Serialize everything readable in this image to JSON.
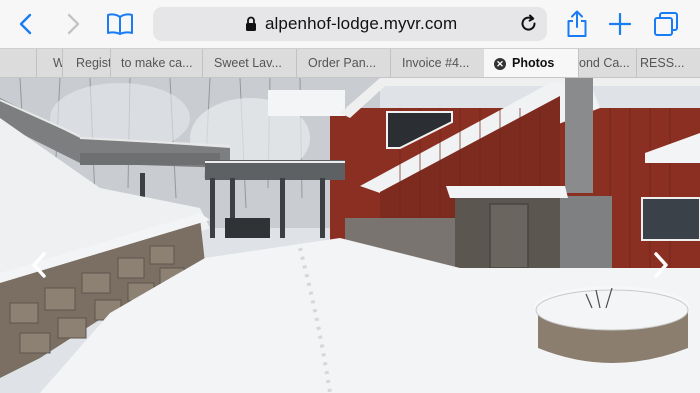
{
  "browser": {
    "url": "alpenhof-lodge.myvr.com",
    "tabs": [
      {
        "label": "W"
      },
      {
        "label": "Regist"
      },
      {
        "label": "to make ca..."
      },
      {
        "label": "Sweet Lav..."
      },
      {
        "label": "Order Pan..."
      },
      {
        "label": "Invoice #4..."
      },
      {
        "label": "Photos",
        "active": true
      },
      {
        "label": "ond Ca..."
      },
      {
        "label": "RESS..."
      }
    ]
  },
  "icons": {
    "back": "chevron-left-icon",
    "forward": "chevron-right-icon",
    "bookmarks": "book-icon",
    "lock": "lock-icon",
    "reload": "reload-icon",
    "share": "share-icon",
    "new_tab": "plus-icon",
    "tabs_overview": "tabs-icon",
    "close_tab": "close-circle-icon"
  },
  "colors": {
    "accent": "#1a7cf5",
    "barn_red": "#8b2f22",
    "snow": "#f3f4f6"
  },
  "gallery": {
    "prev_icon": "chevron-left-icon",
    "next_icon": "chevron-right-icon"
  }
}
